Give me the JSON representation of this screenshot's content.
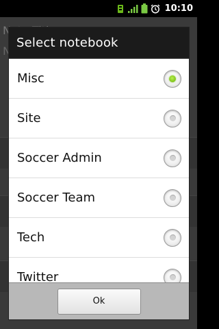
{
  "status_bar": {
    "time": "10:10",
    "icons": [
      "sync-icon",
      "signal-icon",
      "battery-icon",
      "alarm-icon"
    ]
  },
  "background_app": {
    "title_partial": "Note Title",
    "subtitle_partial": "N"
  },
  "dialog": {
    "title": "Select notebook",
    "options": [
      {
        "label": "Misc",
        "checked": true
      },
      {
        "label": "Site",
        "checked": false
      },
      {
        "label": "Soccer Admin",
        "checked": false
      },
      {
        "label": "Soccer Team",
        "checked": false
      },
      {
        "label": "Tech",
        "checked": false
      },
      {
        "label": "Twitter",
        "checked": false
      }
    ],
    "ok_label": "Ok"
  },
  "colors": {
    "radio_selected": "#7fc31a",
    "header_bg": "#1b1b1b",
    "footer_bg": "#b8b8b8"
  }
}
